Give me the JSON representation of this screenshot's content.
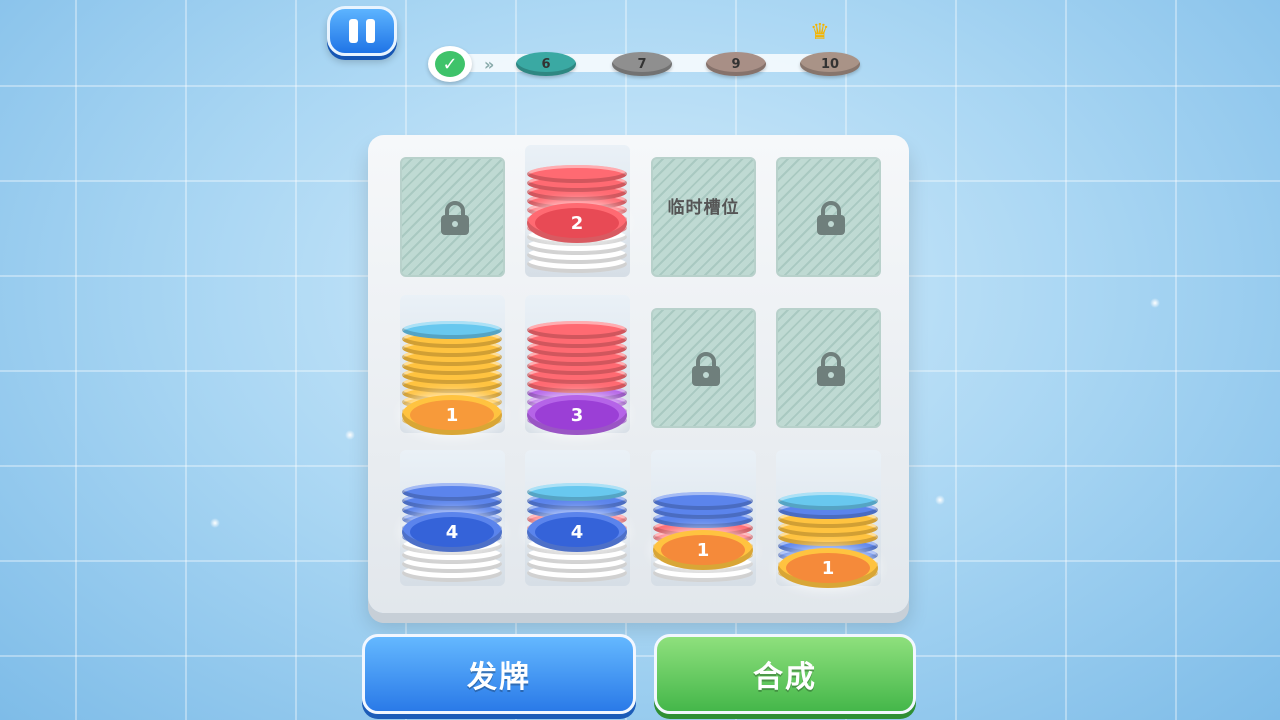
{
  "hud": {
    "pause_icon": "pause-icon",
    "progress": {
      "completed_icon": "check-icon",
      "arrow_icon": "double-chevron-icon",
      "levels": [
        {
          "label": "6",
          "color": "#3aa9a3"
        },
        {
          "label": "7",
          "color": "#8f8f8f"
        },
        {
          "label": "9",
          "color": "#a88f86"
        },
        {
          "label": "10",
          "color": "#a99387"
        }
      ],
      "crown_icon": "crown-icon"
    }
  },
  "board": {
    "temp_slot_label": "临时槽位",
    "lock_icon": "lock-icon",
    "stacks": {
      "top_center": {
        "top_number": "2",
        "top_color": "#e84a55",
        "colors": [
          "#ffffff",
          "#ffffff",
          "#ffffff",
          "#ffffff",
          "#ff6a72",
          "#ff6a72",
          "#ff6a72",
          "#ff6a72",
          "#ff6a72",
          "#ff6a72",
          "#ff6a72"
        ]
      },
      "mid_left": {
        "top_number": "1",
        "top_color": "#f79a3a",
        "colors": [
          "#ffc340",
          "#ffc340",
          "#ffc340",
          "#ffc340",
          "#ffc340",
          "#ffc340",
          "#ffc340",
          "#ffc340",
          "#ffc340",
          "#ffc340",
          "#68c8ef"
        ]
      },
      "mid_center": {
        "top_number": "3",
        "top_color": "#9b3fd6",
        "colors": [
          "#b564e8",
          "#b564e8",
          "#b564e8",
          "#b564e8",
          "#ff6a72",
          "#ff6a72",
          "#ff6a72",
          "#ff6a72",
          "#ff6a72",
          "#ff6a72",
          "#ff6a72"
        ]
      },
      "bot_1": {
        "top_number": "4",
        "top_color": "#3563d9",
        "colors": [
          "#ffffff",
          "#ffffff",
          "#ffffff",
          "#ffffff",
          "#5b84ec",
          "#5b84ec",
          "#5b84ec",
          "#5b84ec",
          "#5b84ec",
          "#5b84ec"
        ]
      },
      "bot_2": {
        "top_number": "4",
        "top_color": "#3563d9",
        "colors": [
          "#ffffff",
          "#ffffff",
          "#ffffff",
          "#ffffff",
          "#5b84ec",
          "#ff6a72",
          "#ff6a72",
          "#5b84ec",
          "#5b84ec",
          "#68c8ef"
        ]
      },
      "bot_3": {
        "top_number": "1",
        "top_color": "#f58a3a",
        "colors": [
          "#ffffff",
          "#ffffff",
          "#ffc340",
          "#ffc340",
          "#ff6a72",
          "#ff6a72",
          "#5b84ec",
          "#5b84ec",
          "#5b84ec"
        ]
      },
      "bot_4": {
        "top_number": "1",
        "top_color": "#f58a3a",
        "colors": [
          "#ffc340",
          "#ffc340",
          "#5b84ec",
          "#5b84ec",
          "#ffc340",
          "#ffc340",
          "#ffc340",
          "#5b84ec",
          "#68c8ef"
        ]
      }
    }
  },
  "actions": {
    "deal_label": "发牌",
    "merge_label": "合成"
  }
}
